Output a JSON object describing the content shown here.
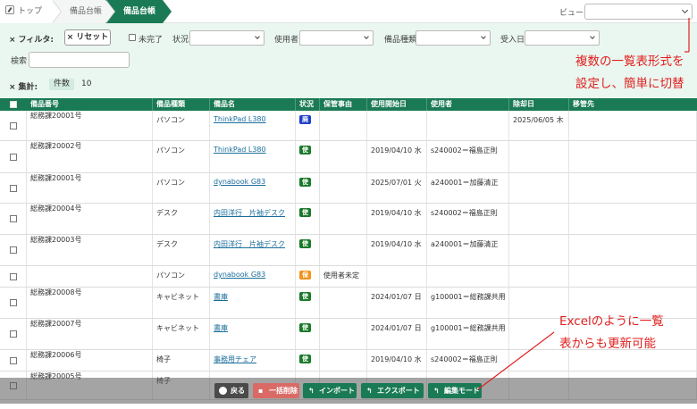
{
  "breadcrumb": [
    "トップ",
    "備品台帳",
    "備品台帳"
  ],
  "view": {
    "label": "ビュー",
    "value": ""
  },
  "filter": {
    "title": "フィルタ:",
    "reset_label": "リセット",
    "incomplete_label": "未完了",
    "status_label": "状況",
    "user_label": "使用者",
    "type_label": "備品種類",
    "received_label": "受入日",
    "search_label": "検索",
    "summary_label": "集計:",
    "count_label": "件数",
    "count_value": "10"
  },
  "columns": [
    "備品番号",
    "備品種類",
    "備品名",
    "状況",
    "保管事由",
    "使用開始日",
    "使用者",
    "除却日",
    "移管先"
  ],
  "rows": [
    {
      "no": "総務課20001号",
      "type": "パソコン",
      "name": "ThinkPad L380",
      "status": "廃",
      "status_color": "#1f3fc9",
      "reason": "",
      "start": "",
      "user": "",
      "removed": "2025/06/05 木",
      "transfer": ""
    },
    {
      "no": "総務課20002号",
      "type": "パソコン",
      "name": "ThinkPad L380",
      "status": "使",
      "status_color": "#1a7a2a",
      "reason": "",
      "start": "2019/04/10 水",
      "user": "s240002＝福島正則",
      "removed": "",
      "transfer": ""
    },
    {
      "no": "総務課20001号",
      "type": "パソコン",
      "name": "dynabook G83",
      "status": "使",
      "status_color": "#1a7a2a",
      "reason": "",
      "start": "2025/07/01 火",
      "user": "a240001＝加藤清正",
      "removed": "",
      "transfer": ""
    },
    {
      "no": "総務課20004号",
      "type": "デスク",
      "name": "内田洋行　片袖デスク",
      "status": "使",
      "status_color": "#1a7a2a",
      "reason": "",
      "start": "2019/04/10 水",
      "user": "s240002＝福島正則",
      "removed": "",
      "transfer": ""
    },
    {
      "no": "総務課20003号",
      "type": "デスク",
      "name": "内田洋行　片袖デスク",
      "status": "使",
      "status_color": "#1a7a2a",
      "reason": "",
      "start": "2019/04/10 水",
      "user": "a240001＝加藤清正",
      "removed": "",
      "transfer": ""
    },
    {
      "no": "",
      "type": "パソコン",
      "name": "dynabook G83",
      "status": "保",
      "status_color": "#f0931c",
      "reason": "使用者未定",
      "start": "",
      "user": "",
      "removed": "",
      "transfer": ""
    },
    {
      "no": "総務課20008号",
      "type": "キャビネット",
      "name": "書庫",
      "status": "使",
      "status_color": "#1a7a2a",
      "reason": "",
      "start": "2024/01/07 日",
      "user": "g100001＝総務課共用",
      "removed": "",
      "transfer": ""
    },
    {
      "no": "総務課20007号",
      "type": "キャビネット",
      "name": "書庫",
      "status": "使",
      "status_color": "#1a7a2a",
      "reason": "",
      "start": "2024/01/07 日",
      "user": "g100001＝総務課共用",
      "removed": "",
      "transfer": ""
    },
    {
      "no": "総務課20006号",
      "type": "椅子",
      "name": "事務用チェア",
      "status": "使",
      "status_color": "#1a7a2a",
      "reason": "",
      "start": "2019/04/10 水",
      "user": "s240002＝福島正則",
      "removed": "",
      "transfer": ""
    },
    {
      "no": "総務課20005号",
      "type": "椅子",
      "name": "",
      "status": "",
      "status_color": "#1a7a2a",
      "reason": "",
      "start": "",
      "user": "",
      "removed": "",
      "transfer": ""
    }
  ],
  "toolbar": {
    "back": "戻る",
    "bulk_delete": "一括削除",
    "import": "インポート",
    "export": "エクスポート",
    "edit_mode": "編集モード"
  },
  "annotations": {
    "top_line1": "複数の一覧表形式を",
    "top_line2": "設定し、簡単に切替",
    "bottom_line1": "Excelのように一覧",
    "bottom_line2": "表からも更新可能"
  },
  "colors": {
    "primary": "#1a7a56",
    "filter_bg": "#eaf6f0",
    "annotation": "#e0201e",
    "delete": "#d9534f"
  }
}
